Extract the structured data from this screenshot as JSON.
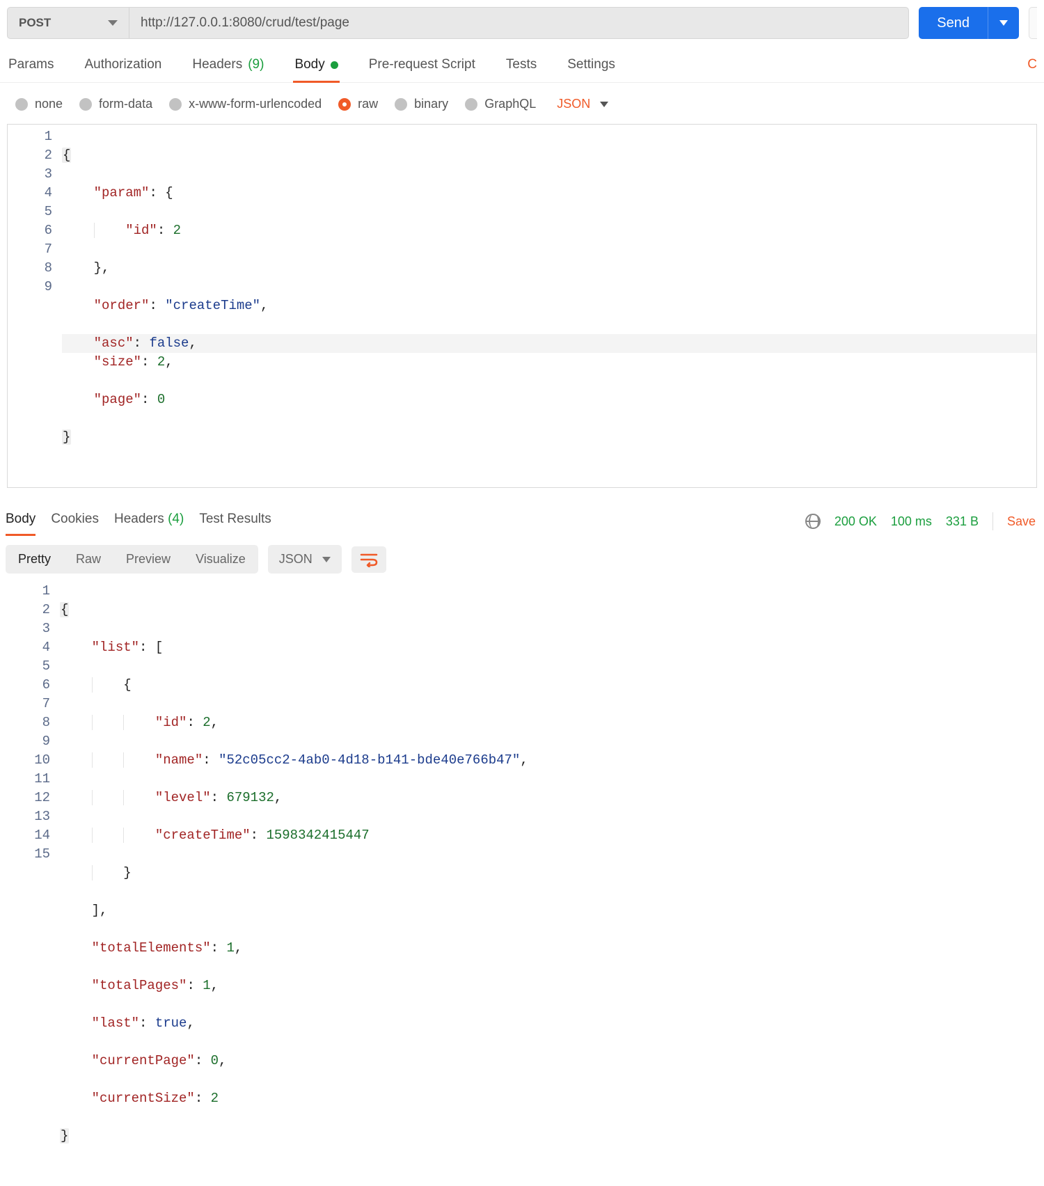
{
  "request": {
    "method": "POST",
    "url": "http://127.0.0.1:8080/crud/test/page",
    "send_label": "Send"
  },
  "tabs": {
    "params": "Params",
    "auth": "Authorization",
    "headers": "Headers",
    "headers_count": "(9)",
    "body": "Body",
    "prerequest": "Pre-request Script",
    "tests": "Tests",
    "settings": "Settings",
    "right_cut": "C"
  },
  "body_types": {
    "none": "none",
    "formdata": "form-data",
    "urlencoded": "x-www-form-urlencoded",
    "raw": "raw",
    "binary": "binary",
    "graphql": "GraphQL",
    "lang": "JSON"
  },
  "request_body": {
    "lines": [
      "1",
      "2",
      "3",
      "4",
      "5",
      "6",
      "7",
      "8",
      "9"
    ],
    "content": {
      "param": {
        "id": 2
      },
      "order": "createTime",
      "asc": false,
      "size": 2,
      "page": 0
    },
    "tokens": {
      "l1": "{",
      "l2_k": "\"param\"",
      "l2_r": ": {",
      "l3_k": "\"id\"",
      "l3_c": ": ",
      "l3_v": "2",
      "l4": "},",
      "l5_k": "\"order\"",
      "l5_c": ": ",
      "l5_v": "\"createTime\"",
      "l5_e": ",",
      "l6_k": "\"asc\"",
      "l6_c": ": ",
      "l6_v": "false",
      "l6_e": ",",
      "l7_k": "\"size\"",
      "l7_c": ": ",
      "l7_v": "2",
      "l7_e": ",",
      "l8_k": "\"page\"",
      "l8_c": ": ",
      "l8_v": "0",
      "l9": "}"
    }
  },
  "response_tabs": {
    "body": "Body",
    "cookies": "Cookies",
    "headers": "Headers",
    "headers_count": "(4)",
    "test_results": "Test Results"
  },
  "status": {
    "code": "200 OK",
    "time": "100 ms",
    "size": "331 B",
    "save": "Save"
  },
  "views": {
    "pretty": "Pretty",
    "raw": "Raw",
    "preview": "Preview",
    "visualize": "Visualize",
    "lang": "JSON"
  },
  "response_body": {
    "lines": [
      "1",
      "2",
      "3",
      "4",
      "5",
      "6",
      "7",
      "8",
      "9",
      "10",
      "11",
      "12",
      "13",
      "14",
      "15"
    ],
    "content": {
      "list": [
        {
          "id": 2,
          "name": "52c05cc2-4ab0-4d18-b141-bde40e766b47",
          "level": 679132,
          "createTime": 1598342415447
        }
      ],
      "totalElements": 1,
      "totalPages": 1,
      "last": true,
      "currentPage": 0,
      "currentSize": 2
    },
    "tokens": {
      "l1": "{",
      "l2_k": "\"list\"",
      "l2_r": ": [",
      "l3": "{",
      "l4_k": "\"id\"",
      "l4_c": ": ",
      "l4_v": "2",
      "l4_e": ",",
      "l5_k": "\"name\"",
      "l5_c": ": ",
      "l5_v": "\"52c05cc2-4ab0-4d18-b141-bde40e766b47\"",
      "l5_e": ",",
      "l6_k": "\"level\"",
      "l6_c": ": ",
      "l6_v": "679132",
      "l6_e": ",",
      "l7_k": "\"createTime\"",
      "l7_c": ": ",
      "l7_v": "1598342415447",
      "l8": "}",
      "l9": "],",
      "l10_k": "\"totalElements\"",
      "l10_c": ": ",
      "l10_v": "1",
      "l10_e": ",",
      "l11_k": "\"totalPages\"",
      "l11_c": ": ",
      "l11_v": "1",
      "l11_e": ",",
      "l12_k": "\"last\"",
      "l12_c": ": ",
      "l12_v": "true",
      "l12_e": ",",
      "l13_k": "\"currentPage\"",
      "l13_c": ": ",
      "l13_v": "0",
      "l13_e": ",",
      "l14_k": "\"currentSize\"",
      "l14_c": ": ",
      "l14_v": "2",
      "l15": "}"
    }
  }
}
